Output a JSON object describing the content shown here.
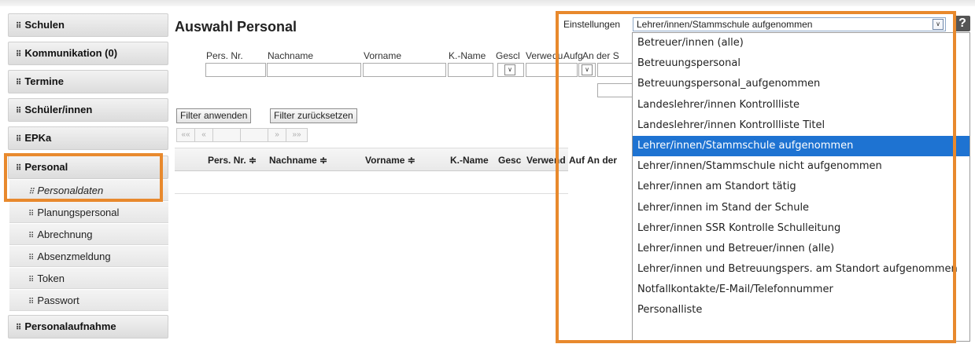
{
  "sidebar": {
    "main_items": [
      {
        "label": "Schulen"
      },
      {
        "label": "Kommunikation (0)"
      },
      {
        "label": "Termine"
      },
      {
        "label": "Schüler/innen"
      },
      {
        "label": "EPKa"
      },
      {
        "label": "Personal"
      }
    ],
    "sub_items": [
      {
        "label": "Personaldaten"
      },
      {
        "label": "Planungspersonal"
      },
      {
        "label": "Abrechnung"
      },
      {
        "label": "Absenzmeldung"
      },
      {
        "label": "Token"
      },
      {
        "label": "Passwort"
      }
    ],
    "after_item": {
      "label": "Personalaufnahme"
    },
    "grip_glyph": "⠿"
  },
  "main": {
    "title": "Auswahl Personal",
    "filter_labels": [
      "Pers. Nr.",
      "Nachname",
      "Vorname",
      "K.-Name",
      "Gescl",
      "Verwe",
      "du",
      "Aufg",
      "An der S"
    ],
    "buttons": {
      "apply": "Filter anwenden",
      "reset": "Filter zurücksetzen"
    },
    "pager": [
      "««",
      "«",
      "",
      "",
      "»",
      "»»"
    ],
    "grid_headers": [
      "Pers. Nr. ≑",
      "Nachname ≑",
      "Vorname ≑",
      "K.-Name",
      "Gesc",
      "Verwe",
      "nd",
      "Auf",
      "An der"
    ]
  },
  "settings": {
    "label": "Einstellungen",
    "selected": "Lehrer/innen/Stammschule aufgenommen",
    "help": "?",
    "options": [
      "Betreuer/innen (alle)",
      "Betreuungspersonal",
      "Betreuungspersonal_aufgenommen",
      "Landeslehrer/innen Kontrollliste",
      "Landeslehrer/innen Kontrollliste Titel",
      "Lehrer/innen/Stammschule aufgenommen",
      "Lehrer/innen/Stammschule nicht aufgenommen",
      "Lehrer/innen am Standort tätig",
      "Lehrer/innen im Stand der Schule",
      "Lehrer/innen SSR Kontrolle Schulleitung",
      "Lehrer/innen und Betreuer/innen (alle)",
      "Lehrer/innen und Betreuungspers. am Standort aufgenommen",
      "Notfallkontakte/E-Mail/Telefonnummer",
      "Personalliste"
    ],
    "selected_index": 5
  },
  "colors": {
    "accent_highlight": "#e8892d",
    "selection": "#1e73d2"
  }
}
